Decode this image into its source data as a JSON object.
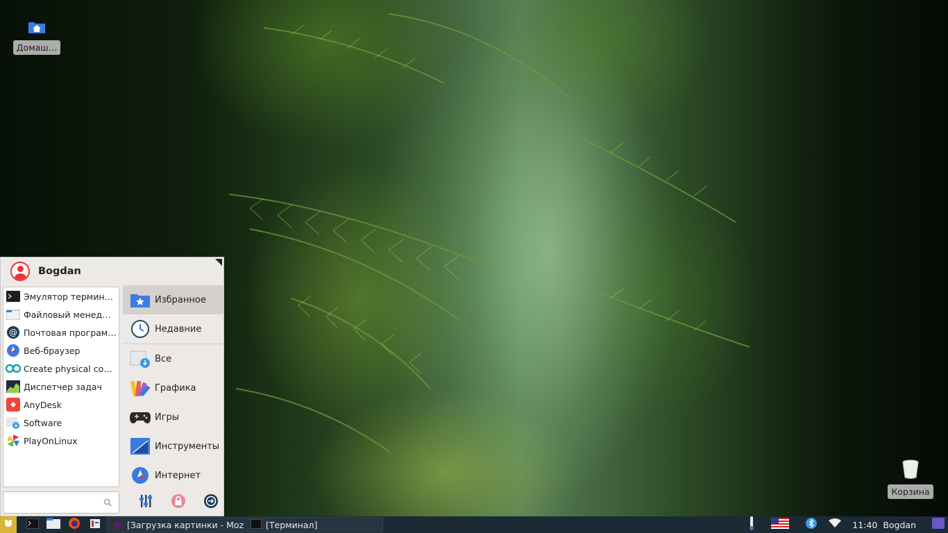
{
  "desktop": {
    "icons": [
      {
        "name": "home-folder",
        "label": "Домаш…"
      },
      {
        "name": "trash",
        "label": "Корзина"
      }
    ]
  },
  "menu": {
    "username": "Bogdan",
    "apps": [
      {
        "label": "Эмулятор терминала",
        "icon": "terminal-icon"
      },
      {
        "label": "Файловый менеджер",
        "icon": "file-manager-icon"
      },
      {
        "label": "Почтовая программа",
        "icon": "mail-icon"
      },
      {
        "label": "Веб-браузер",
        "icon": "web-browser-icon"
      },
      {
        "label": "Create physical com…",
        "icon": "arduino-icon"
      },
      {
        "label": "Диспетчер задач",
        "icon": "task-manager-icon"
      },
      {
        "label": "AnyDesk",
        "icon": "anydesk-icon"
      },
      {
        "label": "Software",
        "icon": "software-icon"
      },
      {
        "label": "PlayOnLinux",
        "icon": "playonlinux-icon"
      }
    ],
    "categories": [
      {
        "label": "Избранное",
        "icon": "favorites-icon",
        "active": true
      },
      {
        "label": "Недавние",
        "icon": "recent-icon"
      },
      {
        "label": "Все",
        "icon": "all-apps-icon"
      },
      {
        "label": "Графика",
        "icon": "graphics-icon"
      },
      {
        "label": "Игры",
        "icon": "games-icon"
      },
      {
        "label": "Инструменты",
        "icon": "tools-icon"
      },
      {
        "label": "Интернет",
        "icon": "internet-icon"
      }
    ],
    "search": {
      "placeholder": "",
      "value": ""
    },
    "actions": [
      "settings-icon",
      "lock-icon",
      "logout-icon"
    ]
  },
  "taskbar": {
    "launchers": [
      "terminal-icon",
      "files-icon",
      "firefox-icon",
      "text-editor-icon"
    ],
    "tasks": [
      {
        "label": "[Загрузка картинки - Mozil…",
        "icon": "firefox-icon"
      },
      {
        "label": "[Терминал]",
        "icon": "terminal-icon"
      }
    ],
    "tray": {
      "keyboard_layout": "us-flag-icon",
      "clock": "11:40",
      "user": "Bogdan"
    }
  },
  "colors": {
    "menu_bg": "#ece9e7",
    "active_category": "#d3d0ce",
    "taskbar_bg": "#1b2a35",
    "start_button": "#d8b43a",
    "accent_blue": "#3a7ae0"
  }
}
